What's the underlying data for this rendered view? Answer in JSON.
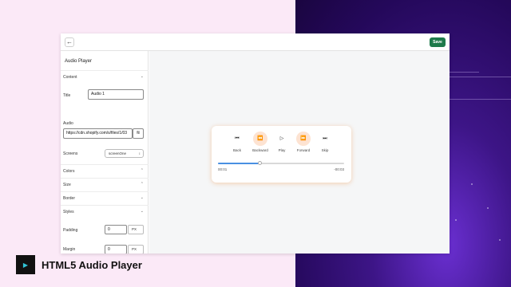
{
  "header": {
    "back_icon": "arrow-left-icon",
    "save_label": "Save",
    "save_color": "#1e7a4b"
  },
  "sidebar": {
    "title": "Audio Player",
    "content_label": "Content",
    "title_field_label": "Title",
    "title_value": "Audio 1",
    "audio_label": "Audio",
    "audio_url": "https://cdn.shopify.com/s/files/1/03",
    "screens_label": "Screens",
    "screens_value": "screenOne",
    "sections": [
      "Colors",
      "Size",
      "Border",
      "Styles"
    ],
    "padding_label": "Padding",
    "padding_value": "0",
    "padding_unit": "PX",
    "margin_label": "Margin",
    "margin_value": "0",
    "margin_unit": "PX"
  },
  "player": {
    "controls": [
      {
        "label": "Back",
        "icon": "skip-back-icon",
        "highlighted": false
      },
      {
        "label": "Backward",
        "icon": "rewind-icon",
        "highlighted": true
      },
      {
        "label": "Play",
        "icon": "play-icon",
        "highlighted": false
      },
      {
        "label": "Forward",
        "icon": "fast-forward-icon",
        "highlighted": true
      },
      {
        "label": "Skip",
        "icon": "skip-forward-icon",
        "highlighted": false
      }
    ],
    "current_time": "00:01",
    "remaining_time": "-00:03",
    "progress": 0.33,
    "accent": "#4a90e2"
  },
  "footer": {
    "title": "HTML5 Audio Player"
  }
}
